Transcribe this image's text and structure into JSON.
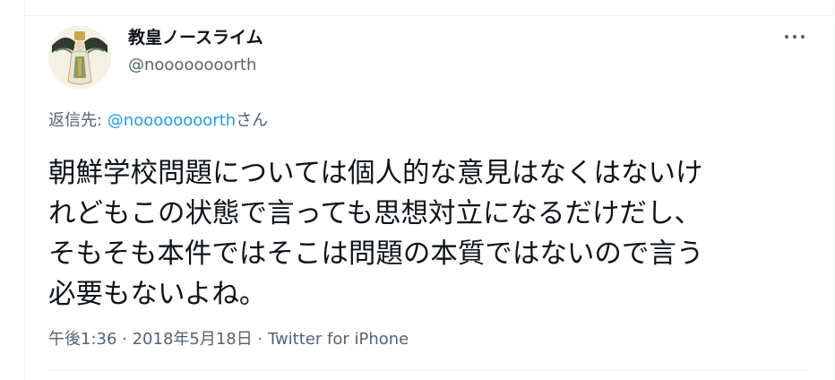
{
  "author": {
    "display_name": "教皇ノースライム",
    "handle": "@noooooooorth"
  },
  "more_icon": "more-horizontal-icon",
  "reply": {
    "prefix": "返信先: ",
    "mention": "@noooooooorth",
    "suffix": "さん"
  },
  "tweet": {
    "text": "朝鮮学校問題については個人的な意見はなくはないけ\nれどもこの状態で言っても思想対立になるだけだし、\nそもそも本件ではそこは問題の本質ではないので言う\n必要もないよね。"
  },
  "meta": {
    "time": "午後1:36",
    "sep1": " · ",
    "date": "2018年5月18日",
    "sep2": " · ",
    "source": "Twitter for iPhone"
  },
  "colors": {
    "link": "#1d9bf0",
    "secondary": "#536471",
    "text": "#0f1419",
    "divider": "#eff3f4"
  }
}
